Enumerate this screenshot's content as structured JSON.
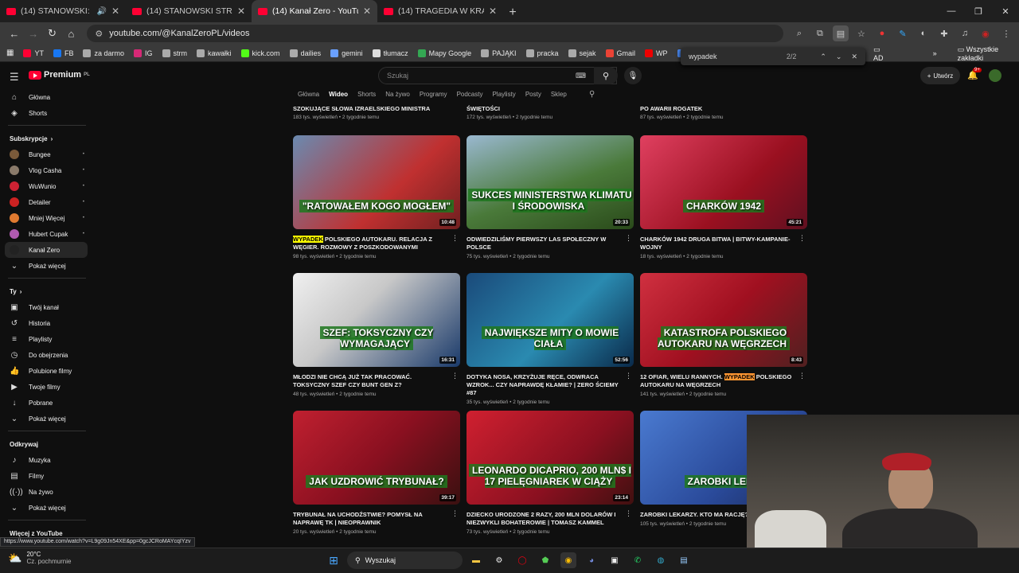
{
  "tabs": [
    {
      "label": "(14) STANOWSKI: PRAWO J",
      "sound": true
    },
    {
      "label": "(14) STANOWSKI STRACIŁ PRAW",
      "sound": false
    },
    {
      "label": "(14) Kanał Zero - YouTube",
      "active": true
    },
    {
      "label": "(14) TRAGEDIA W KRAKOWIE, N",
      "sound": false
    }
  ],
  "address": {
    "url": "youtube.com/@KanalZeroPL/videos"
  },
  "bookmarks": [
    {
      "label": "YT",
      "color": "#ff0033"
    },
    {
      "label": "FB",
      "color": "#1877f2"
    },
    {
      "label": "za darmo",
      "color": "#aaa"
    },
    {
      "label": "IG",
      "color": "#d62976"
    },
    {
      "label": "strm",
      "color": "#aaa"
    },
    {
      "label": "kawałki",
      "color": "#aaa"
    },
    {
      "label": "kick.com",
      "color": "#53fc18"
    },
    {
      "label": "dailies",
      "color": "#aaa"
    },
    {
      "label": "gemini",
      "color": "#6aa0ff"
    },
    {
      "label": "tłumacz",
      "color": "#ddd"
    },
    {
      "label": "Mapy Google",
      "color": "#34a853"
    },
    {
      "label": "PAJĄKI",
      "color": "#aaa"
    },
    {
      "label": "pracka",
      "color": "#aaa"
    },
    {
      "label": "sejak",
      "color": "#aaa"
    },
    {
      "label": "Gmail",
      "color": "#ea4335"
    },
    {
      "label": "WP",
      "color": "#e00"
    },
    {
      "label": "Tłuma",
      "color": "#4a8af4"
    }
  ],
  "bookmarks_right": {
    "ad": "AD",
    "all": "Wszystkie zakładki"
  },
  "find": {
    "query": "wypadek",
    "count": "2/2"
  },
  "youtube": {
    "logo": "Premium",
    "region": "PL",
    "search_placeholder": "Szukaj",
    "create": "Utwórz",
    "notifications": "9+"
  },
  "sidebar": {
    "main": [
      {
        "label": "Główna",
        "icon": "⌂"
      },
      {
        "label": "Shorts",
        "icon": "◈"
      }
    ],
    "subs_header": "Subskrypcje",
    "subs": [
      {
        "label": "Bungee",
        "color": "#7a5a3a"
      },
      {
        "label": "Vlog Casha",
        "color": "#8a7a6a"
      },
      {
        "label": "WuWunio",
        "color": "#cc2233"
      },
      {
        "label": "Detailer",
        "color": "#c22"
      },
      {
        "label": "Mniej Więcej",
        "color": "#e07a30"
      },
      {
        "label": "Hubert Cupak",
        "color": "#b05ab0"
      },
      {
        "label": "Kanał Zero",
        "color": "#222"
      }
    ],
    "subs_more": "Pokaż więcej",
    "you_header": "Ty",
    "you": [
      {
        "label": "Twój kanał",
        "icon": "▣"
      },
      {
        "label": "Historia",
        "icon": "↺"
      },
      {
        "label": "Playlisty",
        "icon": "≡"
      },
      {
        "label": "Do obejrzenia",
        "icon": "◷"
      },
      {
        "label": "Polubione filmy",
        "icon": "👍"
      },
      {
        "label": "Twoje filmy",
        "icon": "▶"
      },
      {
        "label": "Pobrane",
        "icon": "↓"
      },
      {
        "label": "Pokaż więcej",
        "icon": "⌄"
      }
    ],
    "explore_header": "Odkrywaj",
    "explore": [
      {
        "label": "Muzyka",
        "icon": "♪"
      },
      {
        "label": "Filmy",
        "icon": "▤"
      },
      {
        "label": "Na żywo",
        "icon": "((·))"
      },
      {
        "label": "Pokaż więcej",
        "icon": "⌄"
      }
    ],
    "more_header": "Więcej z YouTube"
  },
  "channel_tabs": [
    "Główna",
    "Wideo",
    "Shorts",
    "Na żywo",
    "Programy",
    "Podcasty",
    "Playlisty",
    "Posty",
    "Sklep"
  ],
  "prev_row": [
    {
      "title": "SZOKUJĄCE SŁOWA IZRAELSKIEGO MINISTRA",
      "meta": "183 tys. wyświetleń • 2 tygodnie temu"
    },
    {
      "title": "ŚWIĘTOŚCI",
      "meta": "172 tys. wyświetleń • 2 tygodnie temu"
    },
    {
      "title": "PO AWARII ROGATEK",
      "meta": "87 tys. wyświetleń • 2 tygodnie temu"
    }
  ],
  "videos": [
    {
      "pre": "",
      "hl": "WYPADEK",
      "post": " POLSKIEGO AUTOKARU. RELACJA Z WĘGIER. ROZMOWY Z POSZKODOWANYMI",
      "meta": "98 tys. wyświetleń • 2 tygodnie temu",
      "dur": "10:48",
      "cap": "\"RATOWAŁEM KOGO MOGŁEM\"",
      "bg": "linear-gradient(135deg,#6a8ab0,#c03030 60%,#702020)",
      "hlc": "y"
    },
    {
      "pre": "ODWIEDZILIŚMY PIERWSZY LAS SPOŁECZNY W POLSCE",
      "hl": "",
      "post": "",
      "meta": "75 tys. wyświetleń • 2 tygodnie temu",
      "dur": "20:33",
      "cap": "SUKCES MINISTERSTWA KLIMATU I ŚRODOWISKA",
      "bg": "linear-gradient(160deg,#9ab8d0,#4a7a3a 55%,#2a4a1a)"
    },
    {
      "pre": "CHARKÓW 1942 DRUGA BITWA | BITWY-KAMPANIE-WOJNY",
      "hl": "",
      "post": "",
      "meta": "18 tys. wyświetleń • 2 tygodnie temu",
      "dur": "45:21",
      "cap": "CHARKÓW 1942",
      "bg": "linear-gradient(135deg,#e04060,#9a1020 60%,#601020)"
    },
    {
      "pre": "MŁODZI NIE CHCĄ JUŻ TAK PRACOWAĆ. TOKSYCZNY SZEF CZY BUNT GEN Z?",
      "hl": "",
      "post": "",
      "meta": "48 tys. wyświetleń • 2 tygodnie temu",
      "dur": "16:31",
      "cap": "SZEF: TOKSYCZNY CZY WYMAGAJĄCY",
      "bg": "linear-gradient(135deg,#f0f0f0,#c8c8c8 40%,#1a3a6a)"
    },
    {
      "pre": "DOTYKA NOSA, KRZYŻUJE RĘCE, ODWRACA WZROK... CZY NAPRAWDĘ KŁAMIE? | ZERO ŚCIEMY #87",
      "hl": "",
      "post": "",
      "meta": "35 tys. wyświetleń • 2 tygodnie temu",
      "dur": "52:56",
      "cap": "NAJWIĘKSZE MITY O MOWIE CIAŁA",
      "bg": "linear-gradient(135deg,#1a4a7a,#2a8ab0 55%,#0a2a4a)"
    },
    {
      "pre": "12 OFIAR, WIELU RANNYCH. ",
      "hl": "WYPADEK",
      "post": " POLSKIEGO AUTOKARU NA WĘGRZECH",
      "meta": "141 tys. wyświetleń • 2 tygodnie temu",
      "dur": "8:43",
      "cap": "KATASTROFA POLSKIEGO AUTOKARU NA WĘGRZECH",
      "bg": "linear-gradient(135deg,#d03040,#a01020 50%,#502020)",
      "hlc": "o"
    },
    {
      "pre": "TRYBUNAŁ NA UCHODŹSTWIE? POMYSŁ NA NAPRAWĘ TK | NIEOPRAWNIK",
      "hl": "",
      "post": "",
      "meta": "20 tys. wyświetleń • 2 tygodnie temu",
      "dur": "39:17",
      "cap": "JAK UZDROWIĆ TRYBUNAŁ?",
      "bg": "linear-gradient(135deg,#c02030,#8a1020 50%,#3a1010)"
    },
    {
      "pre": "DZIECKO URODZONE 2 RAZY, 200 MLN DOLARÓW I NIEZWYKLI BOHATEROWIE | TOMASZ KAMMEL",
      "hl": "",
      "post": "",
      "meta": "73 tys. wyświetleń • 2 tygodnie temu",
      "dur": "23:14",
      "cap": "LEONARDO DICAPRIO, 200 MLN$ I 17 PIELĘGNIAREK W CIĄŻY",
      "bg": "linear-gradient(135deg,#d02030,#8a1020 60%,#401010)"
    },
    {
      "pre": "ZAROBKI LEKARZY. KTO MA RACJĘ?",
      "hl": "",
      "post": "",
      "meta": "105 tys. wyświetleń • 2 tygodnie temu",
      "dur": "",
      "cap": "ZAROBKI LEKA",
      "bg": "linear-gradient(135deg,#4a7ad0,#2a4a9a 60%,#1a2a5a)"
    }
  ],
  "status_url": "https://www.youtube.com/watch?v=L9g09Jn54XE&pp=0gcJCRoMAYcqIYzv",
  "weather": {
    "temp": "20°C",
    "desc": "Cz. pochmurnie"
  },
  "taskbar": {
    "search": "Wyszukaj"
  }
}
